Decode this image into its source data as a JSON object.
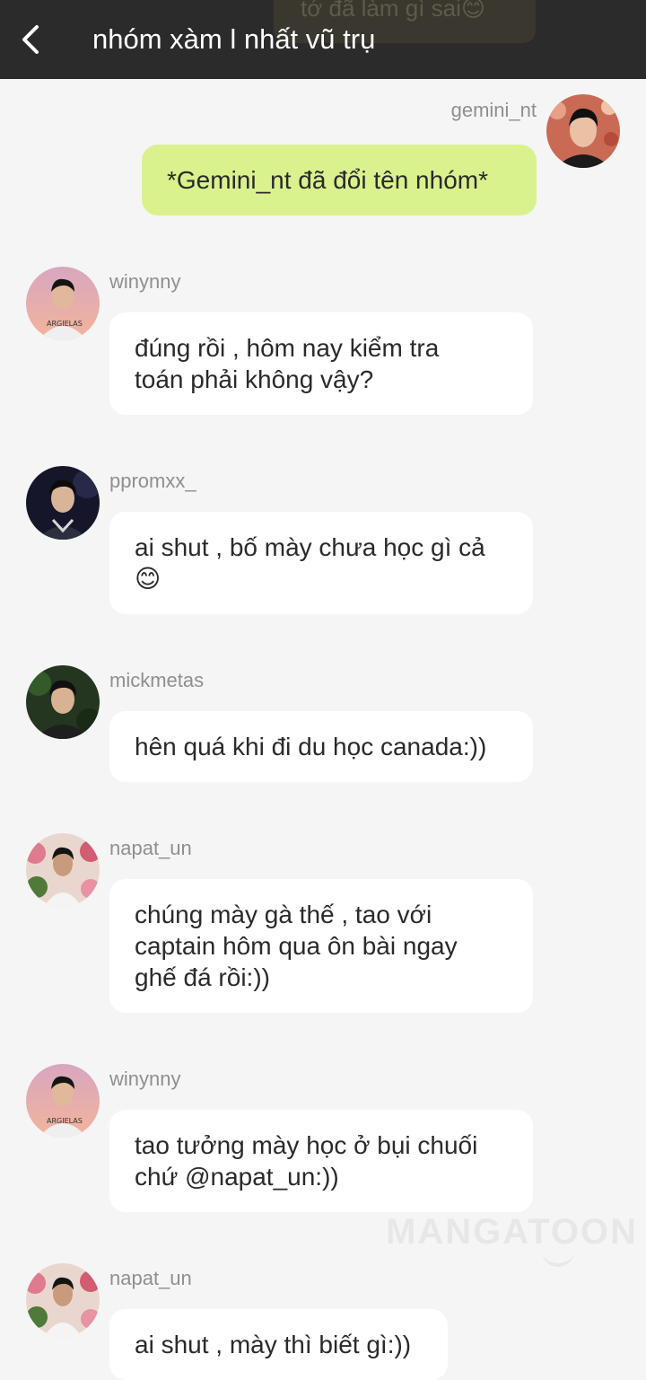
{
  "header": {
    "title": "nhóm xàm l nhất vũ trụ",
    "back_icon": "chevron-left-icon",
    "background": "#2b2b2b",
    "ghost_text": "tớ đã làm gì sai😊"
  },
  "colors": {
    "page_bg": "#f5f5f5",
    "my_bubble": "#d9f28d",
    "other_bubble": "#ffffff",
    "username": "#8f8f8f"
  },
  "messages": [
    {
      "user": "gemini_nt",
      "lines": [
        "*Gemini_nt đã đổi tên nhóm*"
      ],
      "own": true
    },
    {
      "user": "winynny",
      "lines": [
        "đúng rồi , hôm nay kiểm tra",
        "toán phải không vậy?"
      ]
    },
    {
      "user": "ppromxx_",
      "lines": [
        "ai shut , bố mày chưa học gì cả",
        "😊"
      ]
    },
    {
      "user": "mickmetas",
      "lines": [
        "hên quá khi đi du học canada:))"
      ]
    },
    {
      "user": "napat_un",
      "lines": [
        "chúng mày gà thế , tao với",
        "captain hôm qua ôn bài ngay",
        "ghế đá rồi:))"
      ]
    },
    {
      "user": "winynny",
      "lines": [
        "tao tưởng mày học ở bụi chuối",
        "chứ @napat_un:))"
      ]
    },
    {
      "user": "napat_un",
      "lines": [
        "ai shut , mày thì biết gì:))"
      ]
    }
  ],
  "watermark": "MANGATOON"
}
